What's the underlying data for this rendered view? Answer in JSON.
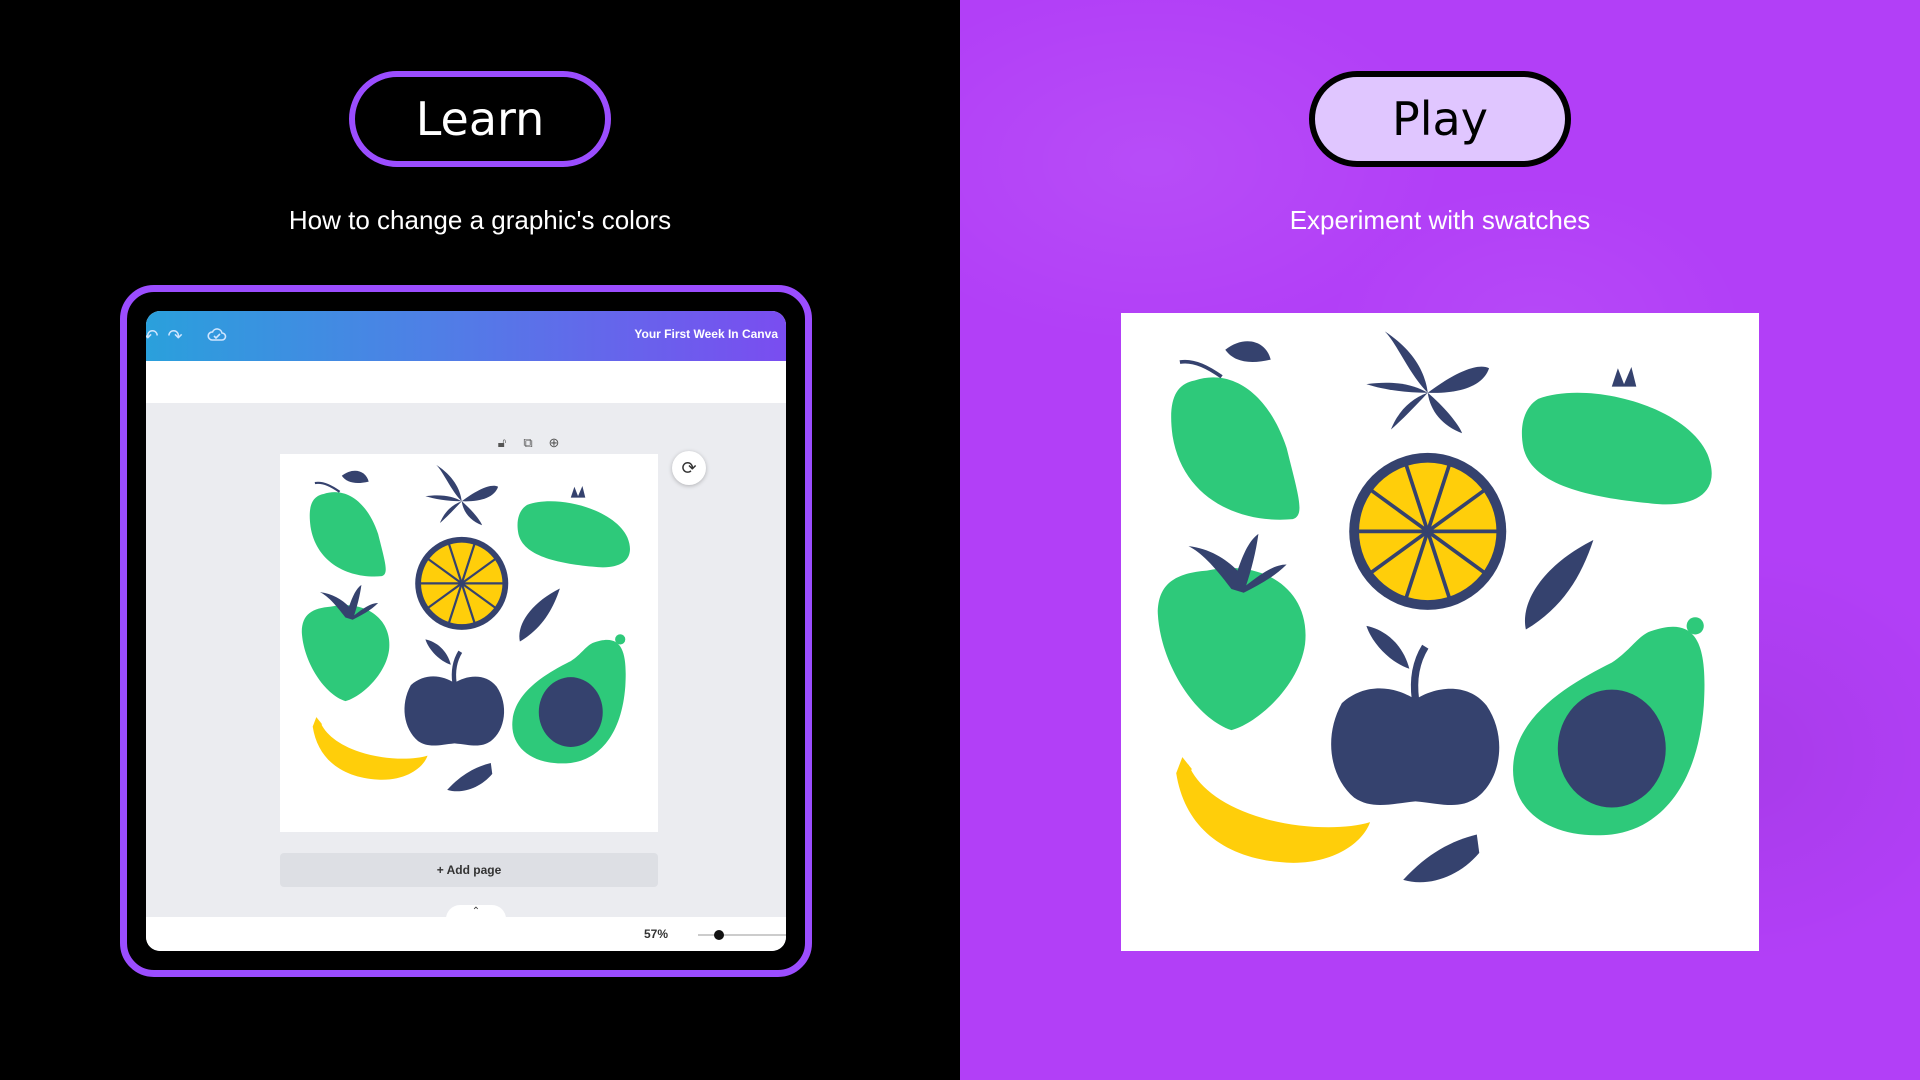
{
  "left": {
    "button_label": "Learn",
    "subtitle": "How to change a graphic's colors",
    "editor": {
      "document_title": "Your First Week In Canva",
      "add_page_label": "+ Add page",
      "zoom_level": "57%"
    }
  },
  "right": {
    "button_label": "Play",
    "subtitle": "Experiment with swatches"
  },
  "colors": {
    "background_left": "#000000",
    "background_right": "#b23ff7",
    "accent_purple": "#9b4dff",
    "play_pill_fill": "#e0c6ff",
    "fruit_green": "#2ec97a",
    "fruit_navy": "#35426e",
    "fruit_yellow": "#ffce0a"
  },
  "icons": {
    "undo": "undo-icon",
    "redo": "redo-icon",
    "saved": "cloud-check-icon",
    "lock": "lock-icon",
    "duplicate": "duplicate-icon",
    "add": "add-icon",
    "rotate": "rotate-icon",
    "chevron": "chevron-up-icon"
  }
}
